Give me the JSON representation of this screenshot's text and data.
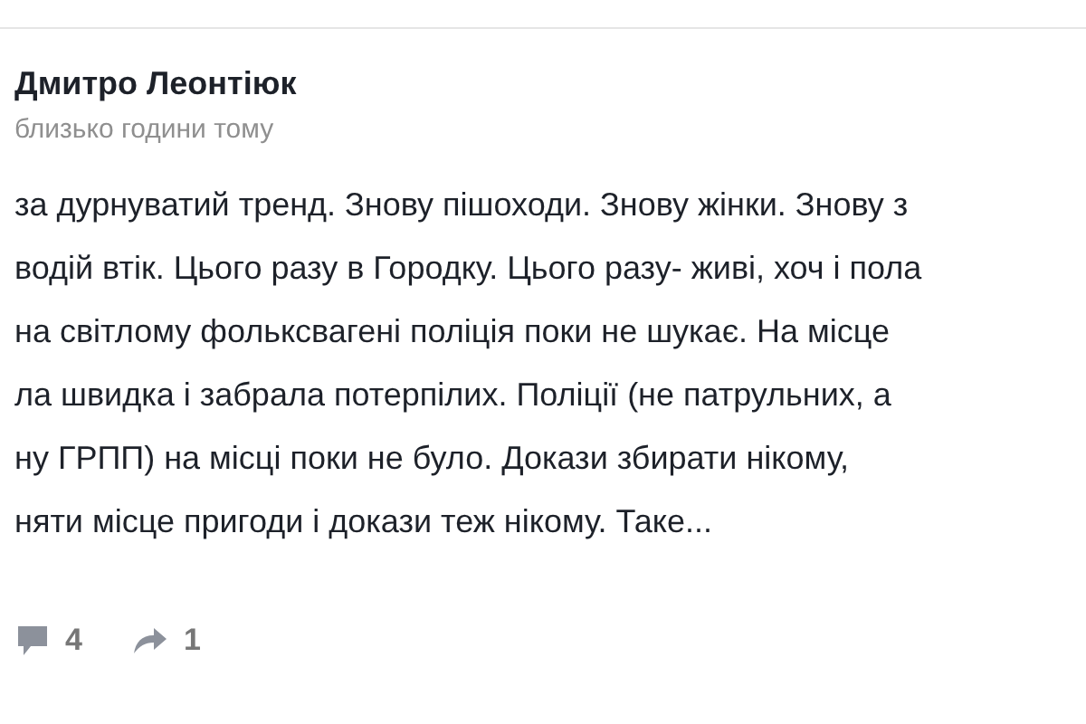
{
  "post": {
    "author": "Дмитро Леонтіюк",
    "time": "близько години тому",
    "lines": [
      "за дурнуватий тренд. Знову пішоходи. Знову жінки. Знову з",
      "водій втік. Цього разу в Городку. Цього разу- живі, хоч і пола",
      "на світлому фольксвагені поліція поки не шукає. На місце",
      "ла швидка і забрала потерпілих. Поліції (не патрульних, а",
      "ну ГРПП) на місці поки не було. Докази збирати нікому,",
      "няти місце пригоди і докази теж нікому. Таке..."
    ],
    "comments": "4",
    "shares": "1"
  }
}
